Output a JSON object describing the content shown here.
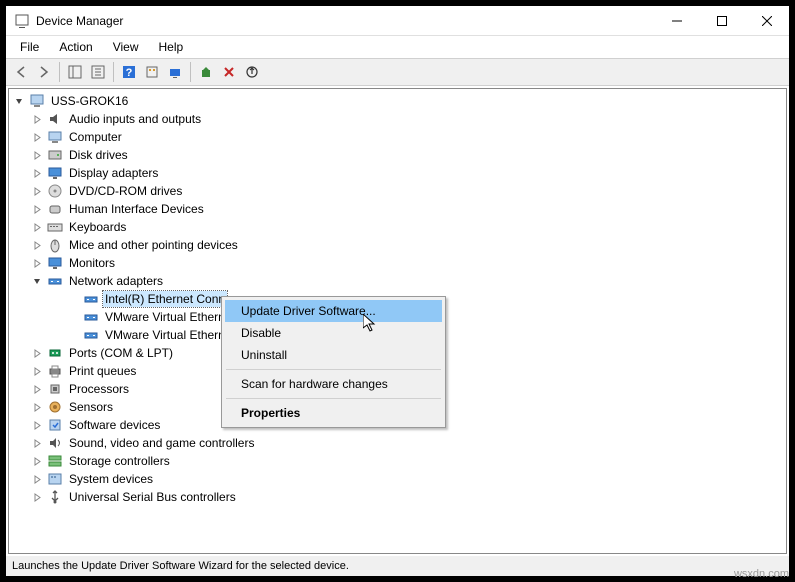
{
  "window": {
    "title": "Device Manager"
  },
  "menubar": [
    "File",
    "Action",
    "View",
    "Help"
  ],
  "tree": {
    "root": "USS-GROK16",
    "categories": [
      {
        "label": "Audio inputs and outputs",
        "icon": "audio"
      },
      {
        "label": "Computer",
        "icon": "computer"
      },
      {
        "label": "Disk drives",
        "icon": "disk"
      },
      {
        "label": "Display adapters",
        "icon": "display"
      },
      {
        "label": "DVD/CD-ROM drives",
        "icon": "dvd"
      },
      {
        "label": "Human Interface Devices",
        "icon": "hid"
      },
      {
        "label": "Keyboards",
        "icon": "keyboard"
      },
      {
        "label": "Mice and other pointing devices",
        "icon": "mouse"
      },
      {
        "label": "Monitors",
        "icon": "monitor"
      },
      {
        "label": "Network adapters",
        "icon": "network",
        "expanded": true,
        "children": [
          {
            "label": "Intel(R) Ethernet Conn",
            "icon": "nic",
            "selected": true
          },
          {
            "label": "VMware Virtual Ethern",
            "icon": "nic"
          },
          {
            "label": "VMware Virtual Ethern",
            "icon": "nic"
          }
        ]
      },
      {
        "label": "Ports (COM & LPT)",
        "icon": "ports"
      },
      {
        "label": "Print queues",
        "icon": "print"
      },
      {
        "label": "Processors",
        "icon": "cpu"
      },
      {
        "label": "Sensors",
        "icon": "sensor"
      },
      {
        "label": "Software devices",
        "icon": "software"
      },
      {
        "label": "Sound, video and game controllers",
        "icon": "sound"
      },
      {
        "label": "Storage controllers",
        "icon": "storage"
      },
      {
        "label": "System devices",
        "icon": "system"
      },
      {
        "label": "Universal Serial Bus controllers",
        "icon": "usb"
      }
    ]
  },
  "contextMenu": {
    "items": [
      {
        "label": "Update Driver Software...",
        "highlighted": true
      },
      {
        "label": "Disable"
      },
      {
        "label": "Uninstall"
      },
      {
        "sep": true
      },
      {
        "label": "Scan for hardware changes"
      },
      {
        "sep": true
      },
      {
        "label": "Properties",
        "bold": true
      }
    ]
  },
  "statusbar": "Launches the Update Driver Software Wizard for the selected device.",
  "watermark": "wsxdn.com"
}
